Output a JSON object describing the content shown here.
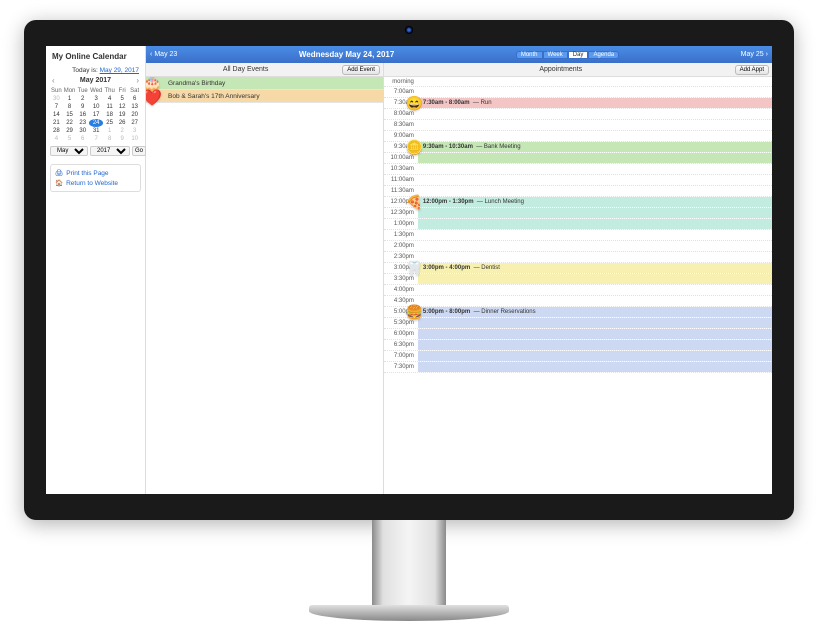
{
  "app": {
    "title": "My Online Calendar"
  },
  "today": {
    "label": "Today is:",
    "date": "May 29, 2017"
  },
  "miniCal": {
    "month": "May",
    "year": "2017",
    "dow": [
      "Sun",
      "Mon",
      "Tue",
      "Wed",
      "Thu",
      "Fri",
      "Sat"
    ],
    "weeks": [
      [
        {
          "n": "30",
          "dim": true
        },
        {
          "n": "1"
        },
        {
          "n": "2"
        },
        {
          "n": "3"
        },
        {
          "n": "4"
        },
        {
          "n": "5"
        },
        {
          "n": "6"
        }
      ],
      [
        {
          "n": "7"
        },
        {
          "n": "8"
        },
        {
          "n": "9"
        },
        {
          "n": "10"
        },
        {
          "n": "11"
        },
        {
          "n": "12"
        },
        {
          "n": "13"
        }
      ],
      [
        {
          "n": "14"
        },
        {
          "n": "15"
        },
        {
          "n": "16"
        },
        {
          "n": "17"
        },
        {
          "n": "18"
        },
        {
          "n": "19"
        },
        {
          "n": "20"
        }
      ],
      [
        {
          "n": "21"
        },
        {
          "n": "22"
        },
        {
          "n": "23"
        },
        {
          "n": "24",
          "today": true
        },
        {
          "n": "25"
        },
        {
          "n": "26"
        },
        {
          "n": "27"
        }
      ],
      [
        {
          "n": "28"
        },
        {
          "n": "29"
        },
        {
          "n": "30"
        },
        {
          "n": "31"
        },
        {
          "n": "1",
          "dim": true
        },
        {
          "n": "2",
          "dim": true
        },
        {
          "n": "3",
          "dim": true
        }
      ],
      [
        {
          "n": "4",
          "dim": true
        },
        {
          "n": "5",
          "dim": true
        },
        {
          "n": "6",
          "dim": true
        },
        {
          "n": "7",
          "dim": true
        },
        {
          "n": "8",
          "dim": true
        },
        {
          "n": "9",
          "dim": true
        },
        {
          "n": "10",
          "dim": true
        }
      ]
    ],
    "selMonth": "May",
    "selYear": "2017",
    "go": "Go"
  },
  "sideLinks": {
    "print": "Print this Page",
    "return": "Return to Website"
  },
  "topbar": {
    "prev": "May 23",
    "title": "Wednesday May 24, 2017",
    "next": "May 25",
    "views": [
      "Month",
      "Week",
      "Day",
      "Agenda"
    ],
    "active": "Day"
  },
  "allDay": {
    "header": "All Day Events",
    "addBtn": "Add Event",
    "events": [
      {
        "title": "Grandma's Birthday",
        "cls": "ev-green",
        "emoji": "🎂"
      },
      {
        "title": "Bob & Sarah's 17th Anniversary",
        "cls": "ev-orange",
        "emoji": "❤️"
      }
    ]
  },
  "appts": {
    "header": "Appointments",
    "addBtn": "Add Appt",
    "morning": "morning",
    "slots": [
      {
        "t": "7:00am"
      },
      {
        "t": "7:30am",
        "cls": "slot-red",
        "time": "7:30am - 8:00am",
        "title": "Run",
        "emoji": "😄"
      },
      {
        "t": "8:00am"
      },
      {
        "t": "8:30am"
      },
      {
        "t": "9:00am"
      },
      {
        "t": "9:30am",
        "cls": "slot-green",
        "time": "9:30am - 10:30am",
        "title": "Bank Meeting",
        "emoji": "🪙",
        "span": 2
      },
      {
        "t": "10:00am",
        "cont": true,
        "cls": "slot-green"
      },
      {
        "t": "10:30am"
      },
      {
        "t": "11:00am"
      },
      {
        "t": "11:30am"
      },
      {
        "t": "12:00pm",
        "cls": "slot-teal",
        "time": "12:00pm - 1:30pm",
        "title": "Lunch Meeting",
        "emoji": "🍕",
        "span": 3
      },
      {
        "t": "12:30pm",
        "cont": true,
        "cls": "slot-teal"
      },
      {
        "t": "1:00pm",
        "cont": true,
        "cls": "slot-teal"
      },
      {
        "t": "1:30pm"
      },
      {
        "t": "2:00pm"
      },
      {
        "t": "2:30pm"
      },
      {
        "t": "3:00pm",
        "cls": "slot-yellow",
        "time": "3:00pm - 4:00pm",
        "title": "Dentist",
        "emoji": "🦷",
        "span": 2
      },
      {
        "t": "3:30pm",
        "cont": true,
        "cls": "slot-yellow"
      },
      {
        "t": "4:00pm"
      },
      {
        "t": "4:30pm"
      },
      {
        "t": "5:00pm",
        "cls": "slot-blue",
        "time": "5:00pm - 8:00pm",
        "title": "Dinner Reservations",
        "emoji": "🍔",
        "span": 6
      },
      {
        "t": "5:30pm",
        "cont": true,
        "cls": "slot-blue"
      },
      {
        "t": "6:00pm",
        "cont": true,
        "cls": "slot-blue"
      },
      {
        "t": "6:30pm",
        "cont": true,
        "cls": "slot-blue"
      },
      {
        "t": "7:00pm",
        "cont": true,
        "cls": "slot-blue"
      },
      {
        "t": "7:30pm",
        "cont": true,
        "cls": "slot-blue"
      }
    ]
  }
}
